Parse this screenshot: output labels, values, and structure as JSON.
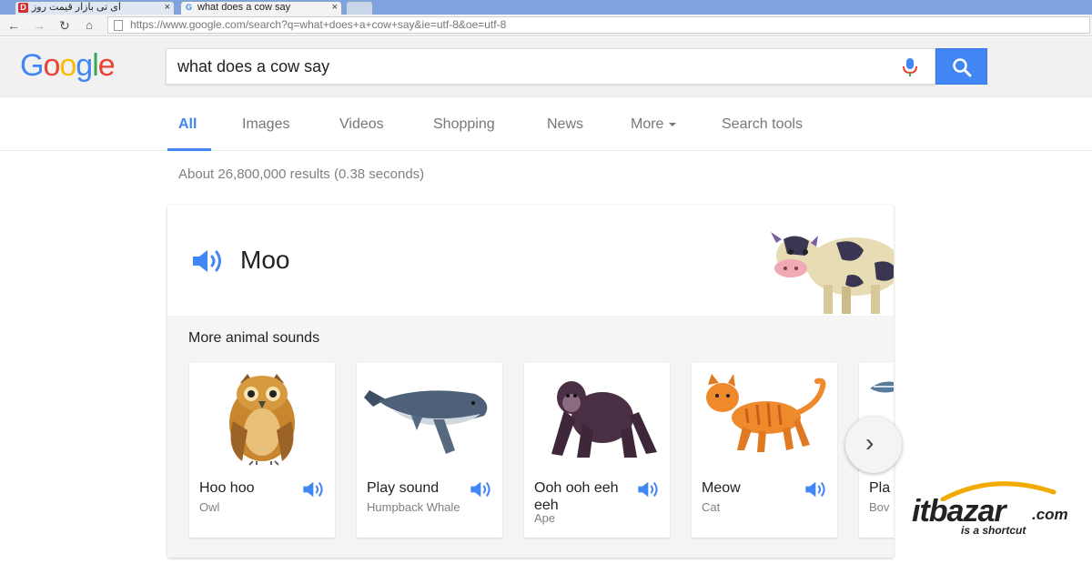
{
  "browser": {
    "tabs": [
      {
        "title": "آی تی بازار قیمت روز",
        "favicon_icon": "itbazar-favicon",
        "close": "×"
      },
      {
        "title": "what does a cow say",
        "favicon_icon": "google-favicon",
        "close": "×"
      }
    ],
    "url": "https://www.google.com/search?q=what+does+a+cow+say&ie=utf-8&oe=utf-8"
  },
  "google": {
    "logo": [
      "G",
      "o",
      "o",
      "g",
      "l",
      "e"
    ],
    "logo_colors": [
      "#4285f4",
      "#ea4335",
      "#fbbc05",
      "#4285f4",
      "#34a853",
      "#ea4335"
    ],
    "query": "what does a cow say",
    "tabs": {
      "all": "All",
      "images": "Images",
      "videos": "Videos",
      "shopping": "Shopping",
      "news": "News",
      "more": "More",
      "search_tools": "Search tools"
    },
    "results_stats": "About 26,800,000 results (0.38 seconds)",
    "accent_color": "#4285f4"
  },
  "answer": {
    "sound": "Moo",
    "more_heading": "More animal sounds",
    "animals": [
      {
        "sound": "Hoo hoo",
        "name": "Owl",
        "icon": "owl-image"
      },
      {
        "sound": "Play sound",
        "name": "Humpback Whale",
        "icon": "whale-image"
      },
      {
        "sound": "Ooh ooh eeh eeh",
        "name": "Ape",
        "icon": "ape-image"
      },
      {
        "sound": "Meow",
        "name": "Cat",
        "icon": "cat-image"
      },
      {
        "sound": "Pla",
        "name": "Bov",
        "icon": "fish-image"
      }
    ]
  },
  "watermark": {
    "brand": "itbazar",
    "domain": ".com",
    "tagline": "is a shortcut"
  }
}
